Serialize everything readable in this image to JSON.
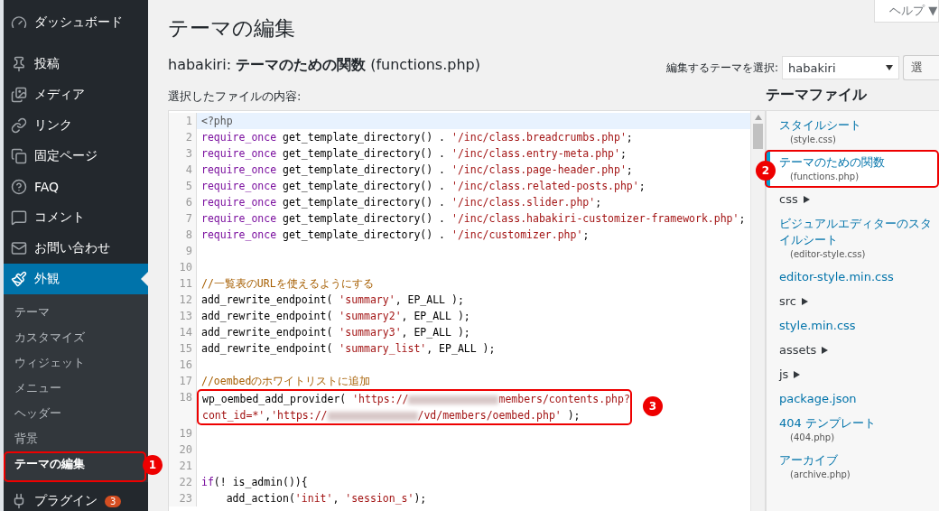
{
  "sidebar": {
    "menu": [
      {
        "label": "ダッシュボード",
        "selected": false
      },
      {
        "label": "投稿",
        "selected": false
      },
      {
        "label": "メディア",
        "selected": false
      },
      {
        "label": "リンク",
        "selected": false
      },
      {
        "label": "固定ページ",
        "selected": false
      },
      {
        "label": "FAQ",
        "selected": false
      },
      {
        "label": "コメント",
        "selected": false
      },
      {
        "label": "お問い合わせ",
        "selected": false
      },
      {
        "label": "外観",
        "selected": true,
        "children": [
          {
            "label": "テーマ",
            "selected": false
          },
          {
            "label": "カスタマイズ",
            "selected": false
          },
          {
            "label": "ウィジェット",
            "selected": false
          },
          {
            "label": "メニュー",
            "selected": false
          },
          {
            "label": "ヘッダー",
            "selected": false
          },
          {
            "label": "背景",
            "selected": false
          },
          {
            "label": "テーマの編集",
            "selected": true,
            "callout": "1"
          }
        ]
      },
      {
        "label": "プラグイン",
        "selected": false,
        "badge": "3"
      }
    ]
  },
  "help_button": "ヘルプ ▼",
  "page_title": "テーマの編集",
  "file_heading": "habakiri: **テーマのための関数** (functions.php)",
  "theme_select": {
    "label": "編集するテーマを選択:",
    "value": "habakiri",
    "button": "選"
  },
  "content_label": "選択したファイルの内容:",
  "editor": {
    "lines": [
      {
        "number": "1",
        "current": true,
        "rows": [
          [
            {
              "kind": "tag",
              "text": "<?php"
            }
          ]
        ]
      },
      {
        "number": "2",
        "current": false,
        "rows": [
          [
            {
              "kind": "keyword",
              "text": "require_once"
            },
            {
              "kind": "plain",
              "text": " get_template_directory() . "
            },
            {
              "kind": "string",
              "text": "'/inc/class.breadcrumbs.php'"
            },
            {
              "kind": "plain",
              "text": ";"
            }
          ]
        ]
      },
      {
        "number": "3",
        "current": false,
        "rows": [
          [
            {
              "kind": "keyword",
              "text": "require_once"
            },
            {
              "kind": "plain",
              "text": " get_template_directory() . "
            },
            {
              "kind": "string",
              "text": "'/inc/class.entry-meta.php'"
            },
            {
              "kind": "plain",
              "text": ";"
            }
          ]
        ]
      },
      {
        "number": "4",
        "current": false,
        "rows": [
          [
            {
              "kind": "keyword",
              "text": "require_once"
            },
            {
              "kind": "plain",
              "text": " get_template_directory() . "
            },
            {
              "kind": "string",
              "text": "'/inc/class.page-header.php'"
            },
            {
              "kind": "plain",
              "text": ";"
            }
          ]
        ]
      },
      {
        "number": "5",
        "current": false,
        "rows": [
          [
            {
              "kind": "keyword",
              "text": "require_once"
            },
            {
              "kind": "plain",
              "text": " get_template_directory() . "
            },
            {
              "kind": "string",
              "text": "'/inc/class.related-posts.php'"
            },
            {
              "kind": "plain",
              "text": ";"
            }
          ]
        ]
      },
      {
        "number": "6",
        "current": false,
        "rows": [
          [
            {
              "kind": "keyword",
              "text": "require_once"
            },
            {
              "kind": "plain",
              "text": " get_template_directory() . "
            },
            {
              "kind": "string",
              "text": "'/inc/class.slider.php'"
            },
            {
              "kind": "plain",
              "text": ";"
            }
          ]
        ]
      },
      {
        "number": "7",
        "current": false,
        "rows": [
          [
            {
              "kind": "keyword",
              "text": "require_once"
            },
            {
              "kind": "plain",
              "text": " get_template_directory() . "
            },
            {
              "kind": "string",
              "text": "'/inc/class.habakiri-customizer-framework.php'"
            },
            {
              "kind": "plain",
              "text": ";"
            }
          ]
        ]
      },
      {
        "number": "8",
        "current": false,
        "rows": [
          [
            {
              "kind": "keyword",
              "text": "require_once"
            },
            {
              "kind": "plain",
              "text": " get_template_directory() . "
            },
            {
              "kind": "string",
              "text": "'/inc/customizer.php'"
            },
            {
              "kind": "plain",
              "text": ";"
            }
          ]
        ]
      },
      {
        "number": "9",
        "current": false,
        "rows": [
          []
        ]
      },
      {
        "number": "10",
        "current": false,
        "rows": [
          []
        ]
      },
      {
        "number": "11",
        "current": false,
        "rows": [
          [
            {
              "kind": "comment",
              "text": "//一覧表のURLを使えるようにする"
            }
          ]
        ]
      },
      {
        "number": "12",
        "current": false,
        "rows": [
          [
            {
              "kind": "plain",
              "text": "add_rewrite_endpoint( "
            },
            {
              "kind": "string",
              "text": "'summary'"
            },
            {
              "kind": "plain",
              "text": ", EP_ALL );"
            }
          ]
        ]
      },
      {
        "number": "13",
        "current": false,
        "rows": [
          [
            {
              "kind": "plain",
              "text": "add_rewrite_endpoint( "
            },
            {
              "kind": "string",
              "text": "'summary2'"
            },
            {
              "kind": "plain",
              "text": ", EP_ALL );"
            }
          ]
        ]
      },
      {
        "number": "14",
        "current": false,
        "rows": [
          [
            {
              "kind": "plain",
              "text": "add_rewrite_endpoint( "
            },
            {
              "kind": "string",
              "text": "'summary3'"
            },
            {
              "kind": "plain",
              "text": ", EP_ALL );"
            }
          ]
        ]
      },
      {
        "number": "15",
        "current": false,
        "rows": [
          [
            {
              "kind": "plain",
              "text": "add_rewrite_endpoint( "
            },
            {
              "kind": "string",
              "text": "'summary_list'"
            },
            {
              "kind": "plain",
              "text": ", EP_ALL );"
            }
          ]
        ]
      },
      {
        "number": "16",
        "current": false,
        "rows": [
          []
        ]
      },
      {
        "number": "17",
        "current": false,
        "rows": [
          [
            {
              "kind": "comment",
              "text": "//oembedのホワイトリストに追加"
            }
          ]
        ]
      },
      {
        "number": "18",
        "current": false,
        "callout": "3",
        "rows": [
          [
            {
              "kind": "plain",
              "text": "wp_oembed_add_provider( "
            },
            {
              "kind": "string",
              "text": "'https://"
            },
            {
              "kind": "redacted"
            },
            {
              "kind": "string",
              "text": "members/contents.php?"
            },
            {
              "kind": "wrap"
            },
            {
              "kind": "string",
              "text": "cont_id=*'"
            },
            {
              "kind": "plain",
              "text": ","
            },
            {
              "kind": "string",
              "text": "'https://"
            },
            {
              "kind": "redacted"
            },
            {
              "kind": "string",
              "text": "/vd/members/oembed.php'"
            },
            {
              "kind": "plain",
              "text": " );"
            }
          ]
        ]
      },
      {
        "number": "19",
        "current": false,
        "rows": [
          []
        ]
      },
      {
        "number": "20",
        "current": false,
        "rows": [
          []
        ]
      },
      {
        "number": "21",
        "current": false,
        "rows": [
          []
        ]
      },
      {
        "number": "22",
        "current": false,
        "rows": [
          [
            {
              "kind": "keyword",
              "text": "if"
            },
            {
              "kind": "plain",
              "text": "(! is_admin()){"
            }
          ]
        ]
      },
      {
        "number": "23",
        "current": false,
        "rows": [
          [
            {
              "kind": "plain",
              "text": "    add_action("
            },
            {
              "kind": "string",
              "text": "'init'"
            },
            {
              "kind": "plain",
              "text": ", "
            },
            {
              "kind": "string",
              "text": "'session_s'"
            },
            {
              "kind": "plain",
              "text": ");"
            }
          ]
        ]
      }
    ]
  },
  "theme_files": {
    "title": "テーマファイル",
    "items": [
      {
        "kind": "file",
        "label": "スタイルシート",
        "file": "(style.css)",
        "selected": false
      },
      {
        "kind": "file",
        "label": "テーマのための関数",
        "file": "(functions.php)",
        "selected": true,
        "callout": "2"
      },
      {
        "kind": "folder",
        "label": "css",
        "selected": false
      },
      {
        "kind": "file",
        "label": "ビジュアルエディターのスタイルシート",
        "file": "(editor-style.css)",
        "selected": false
      },
      {
        "kind": "file",
        "label": "editor-style.min.css",
        "selected": false
      },
      {
        "kind": "folder",
        "label": "src",
        "selected": false
      },
      {
        "kind": "file",
        "label": "style.min.css",
        "selected": false
      },
      {
        "kind": "folder",
        "label": "assets",
        "selected": false
      },
      {
        "kind": "folder",
        "label": "js",
        "selected": false
      },
      {
        "kind": "file",
        "label": "package.json",
        "selected": false
      },
      {
        "kind": "file",
        "label": "404 テンプレート",
        "file": "(404.php)",
        "selected": false
      },
      {
        "kind": "file",
        "label": "アーカイブ",
        "file": "(archive.php)",
        "selected": false
      }
    ]
  }
}
